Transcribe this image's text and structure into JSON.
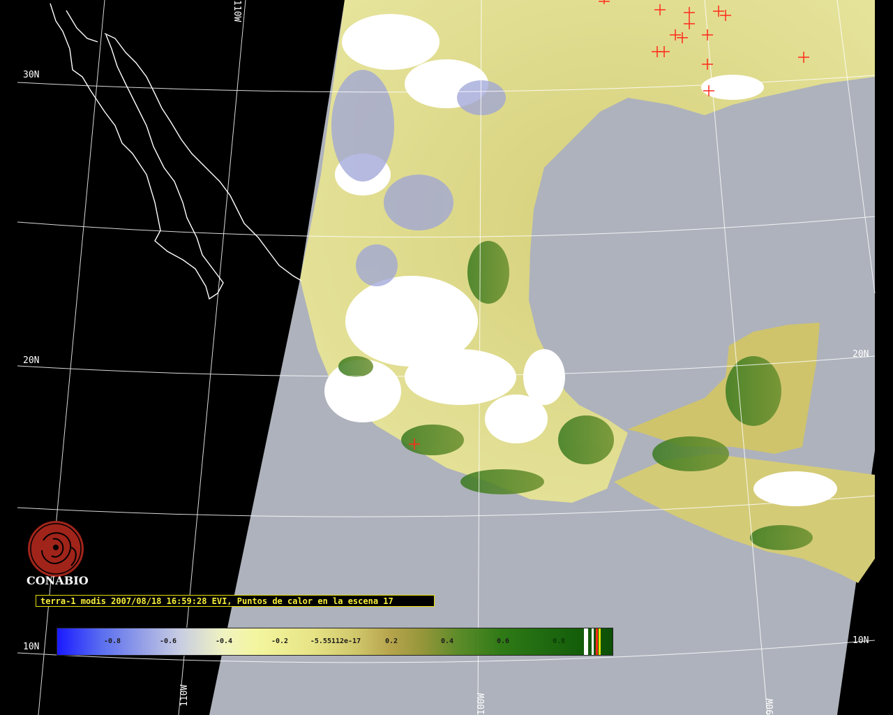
{
  "map": {
    "graticule_labels": {
      "lat_30": "30N",
      "lat_20_left": "20N",
      "lat_20_right": "20N",
      "lat_10_left": "10N",
      "lat_10_right": "10N",
      "lon_110_top": "110W",
      "lon_110_bottom": "110W",
      "lon_100_bottom": "100W",
      "lon_90_bottom": "90W"
    },
    "colors": {
      "space": "#000000",
      "ocean": "#aeb2bc",
      "coast_lines": "#ffffff",
      "graticule": "#ffffff",
      "cloud": "#ffffff",
      "hotspot_marker": "#ff2a1a"
    }
  },
  "logo": {
    "text": "CONABIO",
    "color": "#a0241a"
  },
  "caption": {
    "text": "terra-1 modis 2007/08/18 16:59:28 EVI, Puntos de calor en la escena 17",
    "border_color": "#e8e000",
    "text_color": "#f7ef3b"
  },
  "colorbar": {
    "ticks": [
      "-0.8",
      "-0.6",
      "-0.4",
      "-0.2",
      "-5.55112e-17",
      "0.2",
      "0.4",
      "0.6",
      "0.8"
    ],
    "low_color": "#1a1aff",
    "mid_color": "#f3f59e",
    "high_color": "#0d4f06",
    "swatches": [
      "#ffffff",
      "#ff2a1a",
      "#e8e000"
    ]
  }
}
